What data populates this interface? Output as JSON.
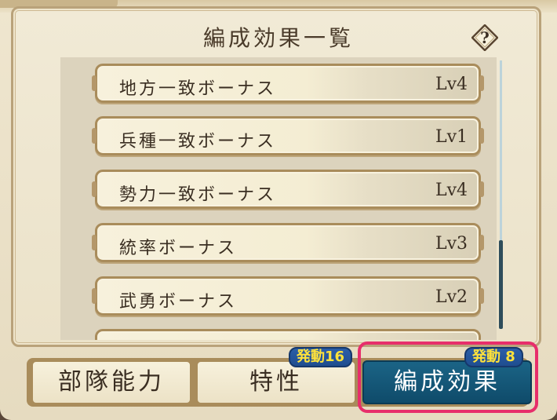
{
  "panel": {
    "title": "編成効果一覧",
    "help_icon": "question-mark-icon"
  },
  "bonuses": [
    {
      "name": "地方一致ボーナス",
      "level": "Lv4"
    },
    {
      "name": "兵種一致ボーナス",
      "level": "Lv1"
    },
    {
      "name": "勢力一致ボーナス",
      "level": "Lv4"
    },
    {
      "name": "統率ボーナス",
      "level": "Lv3"
    },
    {
      "name": "武勇ボーナス",
      "level": "Lv2"
    }
  ],
  "tabs": [
    {
      "label": "部隊能力",
      "badge": ""
    },
    {
      "label": "特性",
      "badge": "発動16"
    },
    {
      "label": "編成効果",
      "badge": "発動 8"
    }
  ],
  "colors": {
    "active_tab": "#0f4b6a",
    "highlight": "#e72e6b",
    "badge_bg": "#1f4d8f",
    "badge_text": "#ffe23b"
  }
}
